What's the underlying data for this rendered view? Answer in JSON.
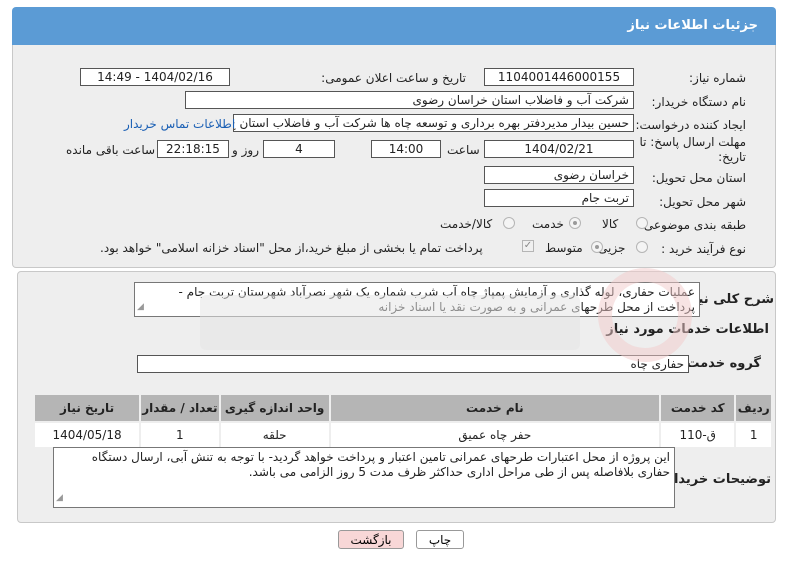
{
  "header": {
    "title": "جزئیات اطلاعات نیاز"
  },
  "fields": {
    "need_number_label": "شماره نیاز:",
    "need_number": "1104001446000155",
    "announce_label": "تاریخ و ساعت اعلان عمومی:",
    "announce_value": "1404/02/16 - 14:49",
    "buyer_org_label": "نام دستگاه خریدار:",
    "buyer_org": "شرکت آب و فاضلاب استان خراسان رضوی",
    "creator_label": "ایجاد کننده درخواست:",
    "creator": "حسین  بیدار مدیردفتر بهره برداری و توسعه چاه ها شرکت آب و فاضلاب استان خ",
    "contact_link": "اطلاعات تماس خریدار",
    "deadline_label_1": "مهلت ارسال پاسخ: تا",
    "deadline_label_2": "تاریخ:",
    "deadline_date": "1404/02/21",
    "time_label": "ساعت",
    "deadline_time": "14:00",
    "days_value": "4",
    "days_label": "روز و",
    "remaining_time": "22:18:15",
    "remaining_label": "ساعت باقی مانده",
    "province_label": "استان محل تحویل:",
    "province": "خراسان رضوی",
    "city_label": "شهر محل تحویل:",
    "city": "تربت جام",
    "category_label": "طبقه بندی موضوعی:",
    "category_options": [
      "کالا",
      "خدمت",
      "کالا/خدمت"
    ],
    "process_label": "نوع فرآیند خرید :",
    "process_options": [
      "جزیی",
      "متوسط"
    ],
    "payment_note": "پرداخت تمام یا بخشی از مبلغ خرید،از محل \"اسناد خزانه اسلامی\" خواهد بود."
  },
  "description": {
    "label": "شرح کلی نیاز:",
    "text": "عملیات حفاری، لوله گذاری و آزمایش پمپاژ چاه آب شرب شماره یک شهر نصرآباد شهرستان تربت جام - پرداخت از محل طرحهای عمرانی و به صورت نقد یا اسناد خزانه"
  },
  "services": {
    "section_title": "اطلاعات خدمات مورد نیاز",
    "group_label": "گروه خدمت:",
    "group_value": "حفاری چاه",
    "columns": [
      "ردیف",
      "کد خدمت",
      "نام خدمت",
      "واحد اندازه گیری",
      "تعداد / مقدار",
      "تاریخ نیاز"
    ],
    "rows": [
      [
        "1",
        "ق-110",
        "حفر چاه عمیق",
        "حلقه",
        "1",
        "1404/05/18"
      ]
    ]
  },
  "buyer_notes": {
    "label": "توضیحات خریدار:",
    "text": "این پروژه از محل اعتبارات طرحهای عمرانی تامین اعتبار و پرداخت خواهد گردید- با توجه به تنش آبی، ارسال دستگاه حفاری بلافاصله پس از طی مراحل اداری حداکثر ظرف مدت 5 روز الزامی می باشد."
  },
  "buttons": {
    "print": "چاپ",
    "back": "بازگشت"
  },
  "colors": {
    "header": "#5b9bd5",
    "panel": "#eeeeee",
    "table_header": "#b5b5b5",
    "back_button": "#f8d7d7",
    "link": "#1a5fb4"
  }
}
